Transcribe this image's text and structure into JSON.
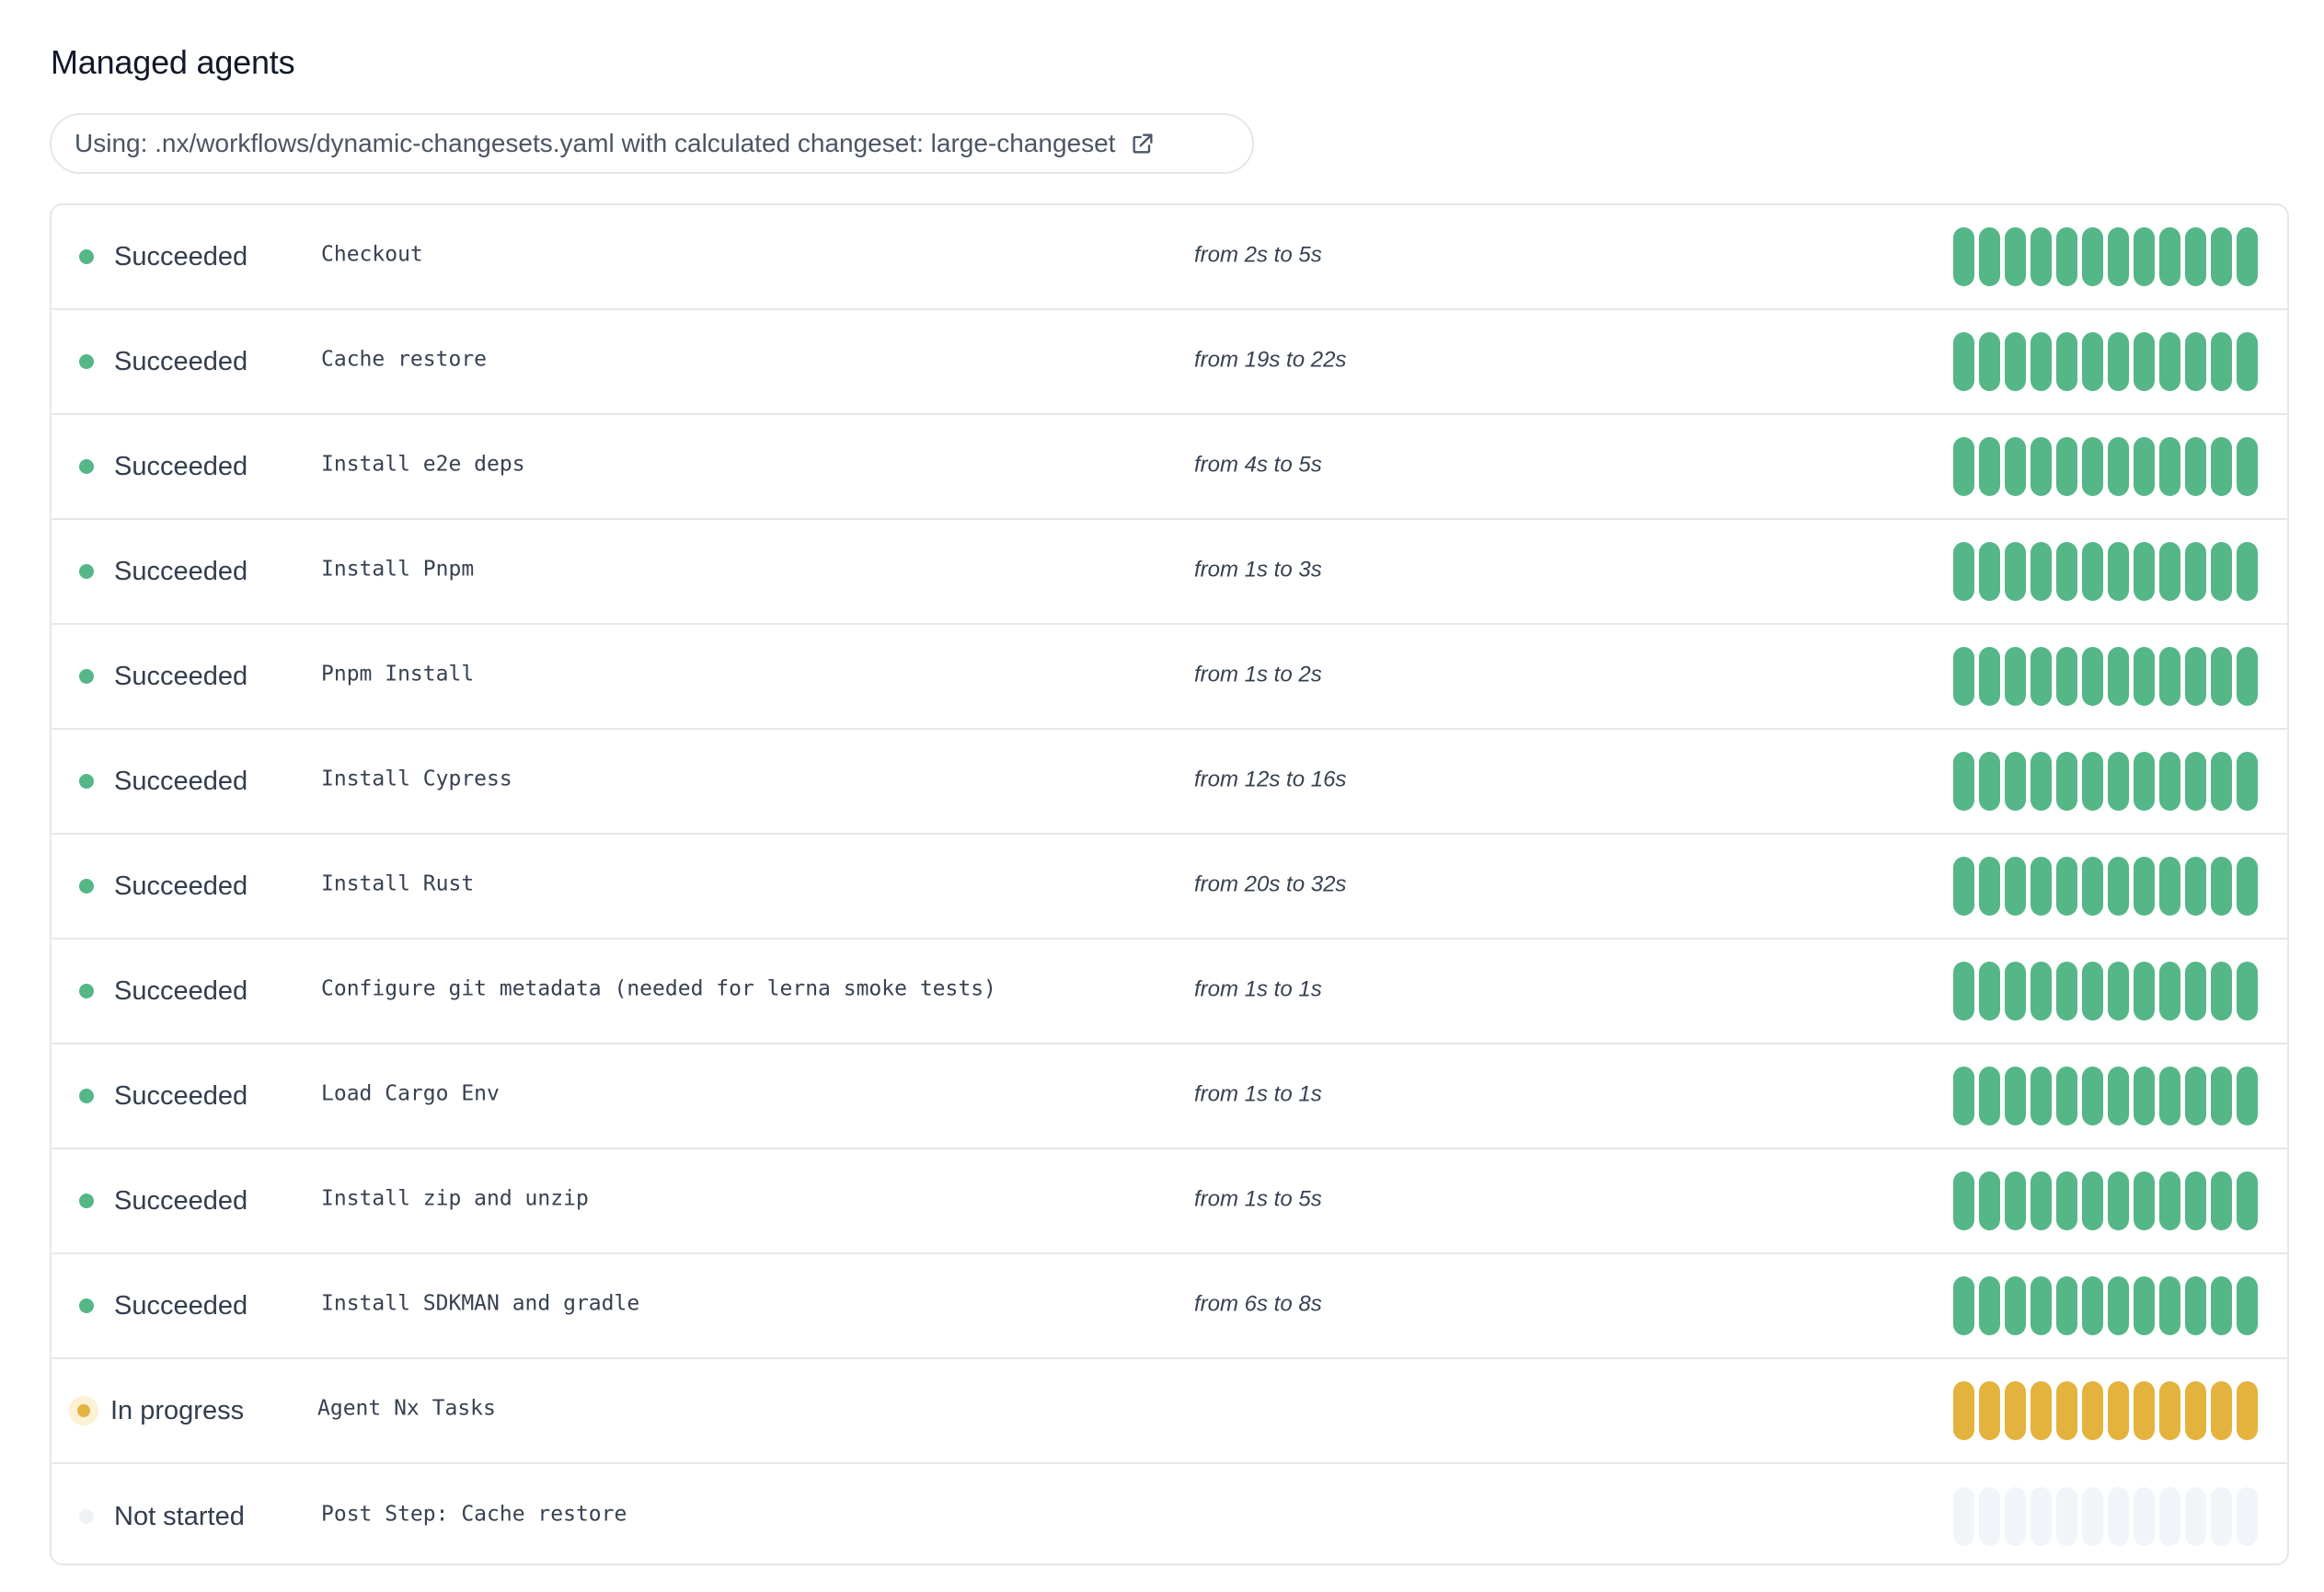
{
  "header": {
    "title": "Managed agents"
  },
  "source": {
    "label": "Using: .nx/workflows/dynamic-changesets.yaml with calculated changeset: large-changeset",
    "icon": "external-link-icon"
  },
  "status_colors": {
    "succeeded": "#55b687",
    "in-progress": "#e3b341",
    "not-started": "#eef2f7"
  },
  "agent_count": 12,
  "steps": [
    {
      "status": "succeeded",
      "status_label": "Succeeded",
      "name": "Checkout",
      "duration": "from 2s to 5s"
    },
    {
      "status": "succeeded",
      "status_label": "Succeeded",
      "name": "Cache restore",
      "duration": "from 19s to 22s"
    },
    {
      "status": "succeeded",
      "status_label": "Succeeded",
      "name": "Install e2e deps",
      "duration": "from 4s to 5s"
    },
    {
      "status": "succeeded",
      "status_label": "Succeeded",
      "name": "Install Pnpm",
      "duration": "from 1s to 3s"
    },
    {
      "status": "succeeded",
      "status_label": "Succeeded",
      "name": "Pnpm Install",
      "duration": "from 1s to 2s"
    },
    {
      "status": "succeeded",
      "status_label": "Succeeded",
      "name": "Install Cypress",
      "duration": "from 12s to 16s"
    },
    {
      "status": "succeeded",
      "status_label": "Succeeded",
      "name": "Install Rust",
      "duration": "from 20s to 32s"
    },
    {
      "status": "succeeded",
      "status_label": "Succeeded",
      "name": "Configure git metadata (needed for lerna smoke tests)",
      "duration": "from 1s to 1s"
    },
    {
      "status": "succeeded",
      "status_label": "Succeeded",
      "name": "Load Cargo Env",
      "duration": "from 1s to 1s"
    },
    {
      "status": "succeeded",
      "status_label": "Succeeded",
      "name": "Install zip and unzip",
      "duration": "from 1s to 5s"
    },
    {
      "status": "succeeded",
      "status_label": "Succeeded",
      "name": "Install SDKMAN and gradle",
      "duration": "from 6s to 8s"
    },
    {
      "status": "in-progress",
      "status_label": "In progress",
      "name": "Agent Nx Tasks",
      "duration": ""
    },
    {
      "status": "not-started",
      "status_label": "Not started",
      "name": "Post Step: Cache restore",
      "duration": ""
    }
  ]
}
